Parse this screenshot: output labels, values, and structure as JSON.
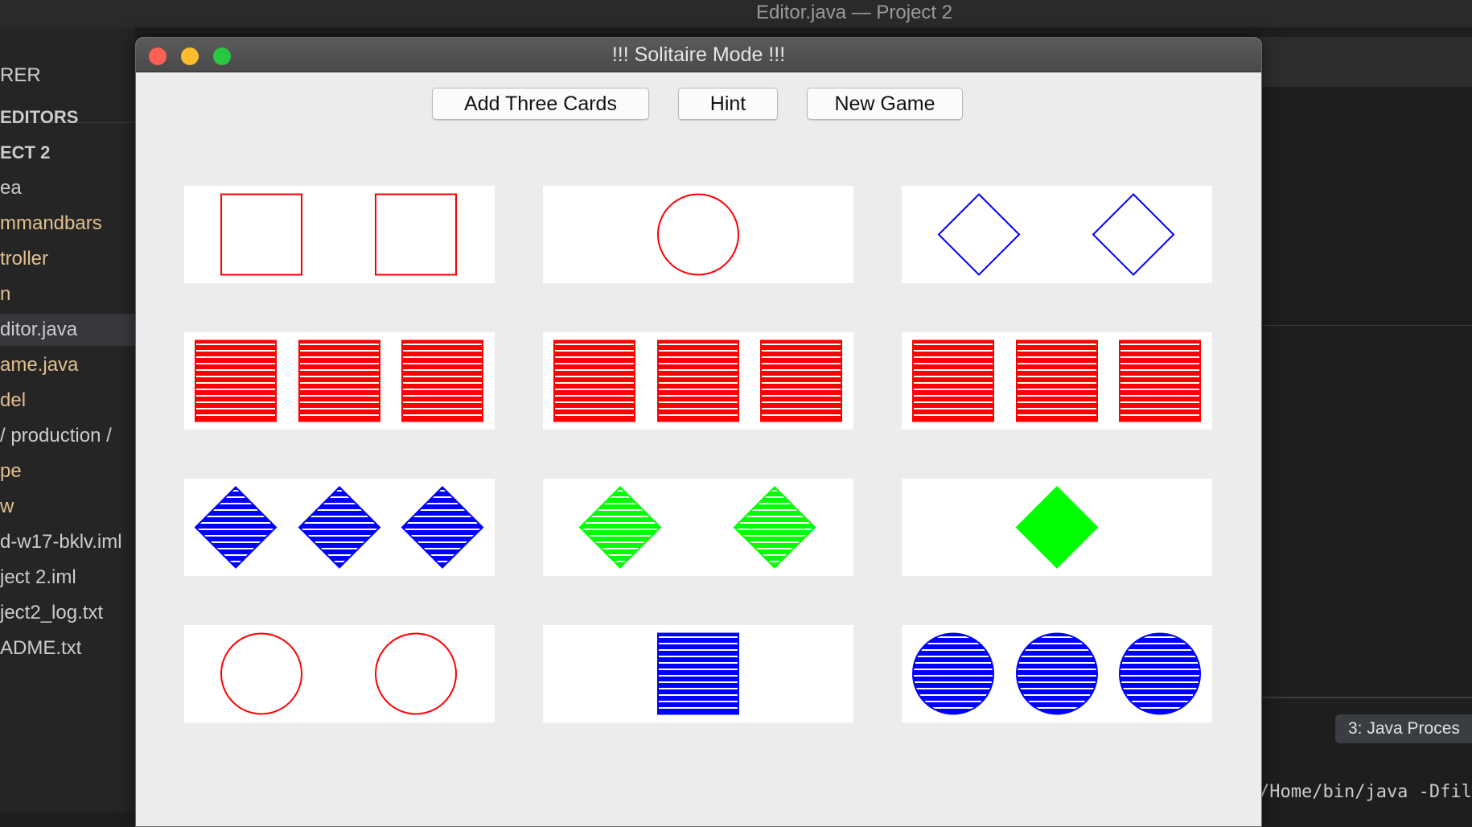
{
  "ide": {
    "window_title": "Editor.java — Project 2",
    "sidebar": [
      {
        "label": "RER",
        "style": "normal"
      },
      {
        "label": "EDITORS",
        "style": "header"
      },
      {
        "label": "ECT 2",
        "style": "header"
      },
      {
        "label": "ea",
        "style": "normal"
      },
      {
        "label": "mmandbars",
        "style": "yellow"
      },
      {
        "label": "troller",
        "style": "yellow"
      },
      {
        "label": "n",
        "style": "yellow"
      },
      {
        "label": "ditor.java",
        "style": "selected"
      },
      {
        "label": "ame.java",
        "style": "yellow"
      },
      {
        "label": "del",
        "style": "yellow"
      },
      {
        "label": "/ production /",
        "style": "normal"
      },
      {
        "label": "pe",
        "style": "yellow"
      },
      {
        "label": "w",
        "style": "yellow"
      },
      {
        "label": "d-w17-bklv.iml",
        "style": "normal"
      },
      {
        "label": "ject 2.iml",
        "style": "normal"
      },
      {
        "label": "ject2_log.txt",
        "style": "normal"
      },
      {
        "label": "ADME.txt",
        "style": "normal"
      }
    ],
    "terminal_tab": "3: Java Proces",
    "terminal_line": "/Home/bin/java -Dfil"
  },
  "window": {
    "title": "!!! Solitaire Mode !!!",
    "buttons": {
      "add_three": "Add Three Cards",
      "hint": "Hint",
      "new_game": "New Game"
    }
  },
  "cards": [
    {
      "shape": "rectangle",
      "color": "#ff0000",
      "fill": "empty",
      "count": 2
    },
    {
      "shape": "oval",
      "color": "#ff0000",
      "fill": "empty",
      "count": 1
    },
    {
      "shape": "diamond",
      "color": "#0000ff",
      "fill": "empty",
      "count": 2
    },
    {
      "shape": "rectangle",
      "color": "#ff0000",
      "fill": "striped",
      "count": 3
    },
    {
      "shape": "rectangle",
      "color": "#ff0000",
      "fill": "striped",
      "count": 3
    },
    {
      "shape": "rectangle",
      "color": "#ff0000",
      "fill": "striped",
      "count": 3
    },
    {
      "shape": "diamond",
      "color": "#0000ff",
      "fill": "striped",
      "count": 3
    },
    {
      "shape": "diamond",
      "color": "#00ff00",
      "fill": "striped",
      "count": 2
    },
    {
      "shape": "diamond",
      "color": "#00ff00",
      "fill": "solid",
      "count": 1
    },
    {
      "shape": "oval",
      "color": "#ff0000",
      "fill": "empty",
      "count": 2
    },
    {
      "shape": "rectangle",
      "color": "#0000ff",
      "fill": "striped",
      "count": 1
    },
    {
      "shape": "oval",
      "color": "#0000ff",
      "fill": "striped",
      "count": 3
    }
  ]
}
